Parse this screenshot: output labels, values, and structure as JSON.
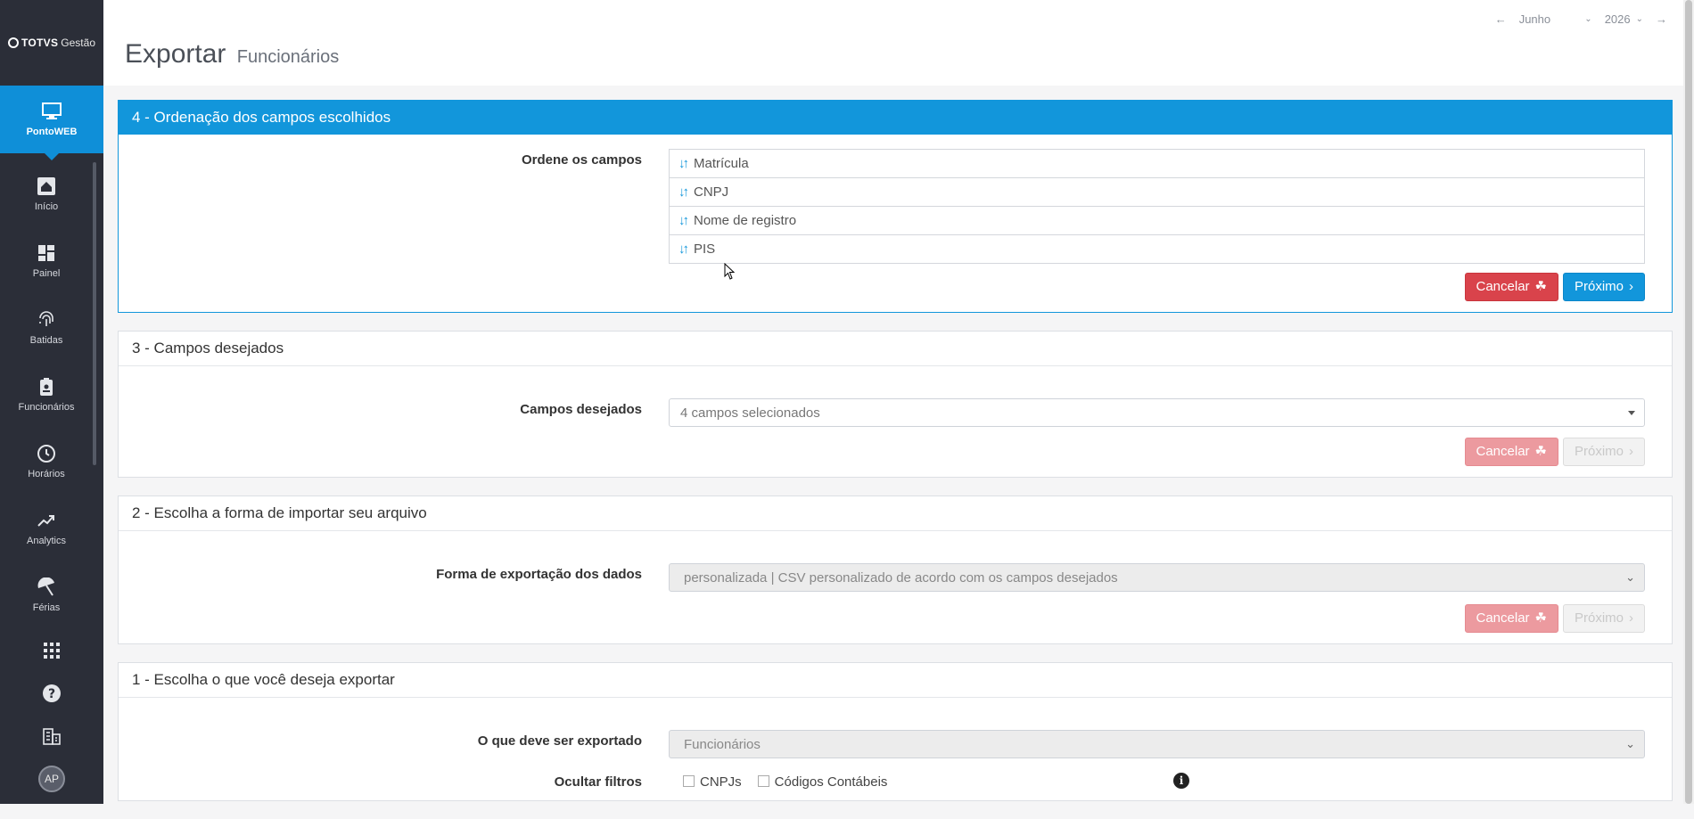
{
  "brand": {
    "name_bold": "TOTVS",
    "name_light": "Gestão"
  },
  "sidebar": {
    "active": {
      "label": "PontoWEB",
      "icon": "monitor-icon"
    },
    "items": [
      {
        "label": "Início",
        "icon": "home-icon"
      },
      {
        "label": "Painel",
        "icon": "dashboard-icon"
      },
      {
        "label": "Batidas",
        "icon": "fingerprint-icon"
      },
      {
        "label": "Funcionários",
        "icon": "badge-icon"
      },
      {
        "label": "Horários",
        "icon": "clock-icon"
      },
      {
        "label": "Analytics",
        "icon": "trend-icon"
      },
      {
        "label": "Férias",
        "icon": "umbrella-icon"
      }
    ],
    "bottom_icons": [
      "apps-grid-icon",
      "help-icon",
      "building-icon"
    ],
    "avatar_initials": "AP"
  },
  "header": {
    "title": "Exportar",
    "subtitle": "Funcionários",
    "month": "Junho",
    "year": "2026"
  },
  "step4": {
    "heading": "4 - Ordenação dos campos escolhidos",
    "label": "Ordene os campos",
    "fields": [
      "Matrícula",
      "CNPJ",
      "Nome de registro",
      "PIS"
    ],
    "cancel": "Cancelar",
    "next": "Próximo"
  },
  "step3": {
    "heading": "3 - Campos desejados",
    "label": "Campos desejados",
    "value": "4 campos selecionados",
    "cancel": "Cancelar",
    "next": "Próximo"
  },
  "step2": {
    "heading": "2 - Escolha a forma de importar seu arquivo",
    "label": "Forma de exportação dos dados",
    "value": "personalizada | CSV personalizado de acordo com os campos desejados",
    "cancel": "Cancelar",
    "next": "Próximo"
  },
  "step1": {
    "heading": "1 - Escolha o que você deseja exportar",
    "label": "O que deve ser exportado",
    "value": "Funcionários",
    "hide_filters_label": "Ocultar filtros",
    "checkboxes": [
      "CNPJs",
      "Códigos Contábeis"
    ]
  },
  "colors": {
    "accent": "#1296db",
    "danger": "#d9434b",
    "sidebar": "#2b2e38"
  }
}
